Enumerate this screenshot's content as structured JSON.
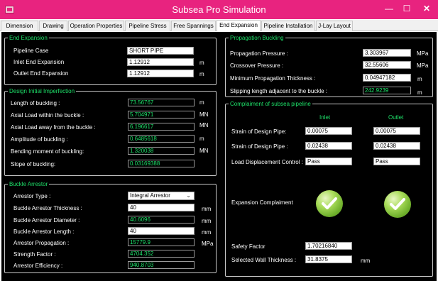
{
  "window": {
    "title": "Subsea Pro Simulation",
    "min_glyph": "—",
    "max_glyph": "☐",
    "close_glyph": "✕"
  },
  "tabs": [
    "Dimension",
    "Drawing",
    "Operation Properties",
    "Pipeline Stress",
    "Free Spannings",
    "End Expansion",
    "Pipeline Installation",
    "J-Lay Layout"
  ],
  "active_tab": "End Expansion",
  "end_expansion": {
    "title": "End Expansion",
    "pipeline_case_label": "Pipeline Case",
    "pipeline_case": "SHORT PIPE",
    "inlet_label": "Inlet End Expansion",
    "inlet_value": "1.12912",
    "inlet_unit": "m",
    "outlet_label": "Outlet End Expansion",
    "outlet_value": "1.12912",
    "outlet_unit": "m"
  },
  "imperfection": {
    "title": "Design Initial Imperfection",
    "rows": [
      {
        "label": "Length of buckling :",
        "value": "73.56767",
        "unit": "m"
      },
      {
        "label": "Axial Load within the buckle :",
        "value": "5.704971",
        "unit": "MN"
      },
      {
        "label": "Axial Load away from the buckle :",
        "value": "6.196617",
        "unit": "MN"
      },
      {
        "label": "Amplitude of buckling :",
        "value": "0.6485618",
        "unit": "m"
      },
      {
        "label": "Bending moment of buckling:",
        "value": "1.320038",
        "unit": "MN"
      },
      {
        "label": "Slope of buckling:",
        "value": "0.03169388",
        "unit": ""
      }
    ]
  },
  "arrestor": {
    "title": "Buckle Arrestor",
    "type_label": "Arrestor Type :",
    "type_value": "Integral Arrestor",
    "thickness_label": "Buckle Arrestor Thickness :",
    "thickness_value": "40",
    "thickness_unit": "mm",
    "diameter_label": "Buckle Arrestor Diameter :",
    "diameter_value": "40.6096",
    "diameter_unit": "mm",
    "length_label": "Buckle Arrestor Length :",
    "length_value": "40",
    "length_unit": "mm",
    "propagation_label": "Arrestor Propagation :",
    "propagation_value": "15779.9",
    "propagation_unit": "MPa",
    "strength_label": "Strength Factor :",
    "strength_value": "4704.352",
    "efficiency_label": "Arrestor Efficiency :",
    "efficiency_value": "940.8703"
  },
  "propagation": {
    "title": "Propagation Buckling",
    "pressure_label": "Propagation Pressure :",
    "pressure_value": "3.303967",
    "pressure_unit": "MPa",
    "crossover_label": "Crossover Pressure :",
    "crossover_value": "32.55606",
    "crossover_unit": "MPa",
    "min_thickness_label": "Minimum Propagation Thickness :",
    "min_thickness_value": "0.04947182",
    "min_thickness_unit": "m",
    "slipping_label": "Slipping length adjacent to the buckle :",
    "slipping_value": "242.9239",
    "slipping_unit": "m"
  },
  "compliance": {
    "title": "Complaiment of subsea pipeline",
    "inlet_header": "Inlet",
    "outlet_header": "Outlet",
    "strain1_label": "Strain of Design Pipe:",
    "strain1_inlet": "0.00075",
    "strain1_outlet": "0.00075",
    "strain2_label": "Strain of Design Pipe :",
    "strain2_inlet": "0.02438",
    "strain2_outlet": "0.02438",
    "load_label": "Load Displacement Control :",
    "load_inlet": "Pass",
    "load_outlet": "Pass",
    "expansion_label": "Expansion Complaiment",
    "safety_label": "Safety Factor",
    "safety_value": "1.70216840",
    "wall_label": "Selected Wall Thickness :",
    "wall_value": "31.8375",
    "wall_unit": "mm"
  },
  "colors": {
    "titlebar": "#e8237f",
    "panel_bg": "#000000",
    "accent_green": "#1ee26a"
  }
}
